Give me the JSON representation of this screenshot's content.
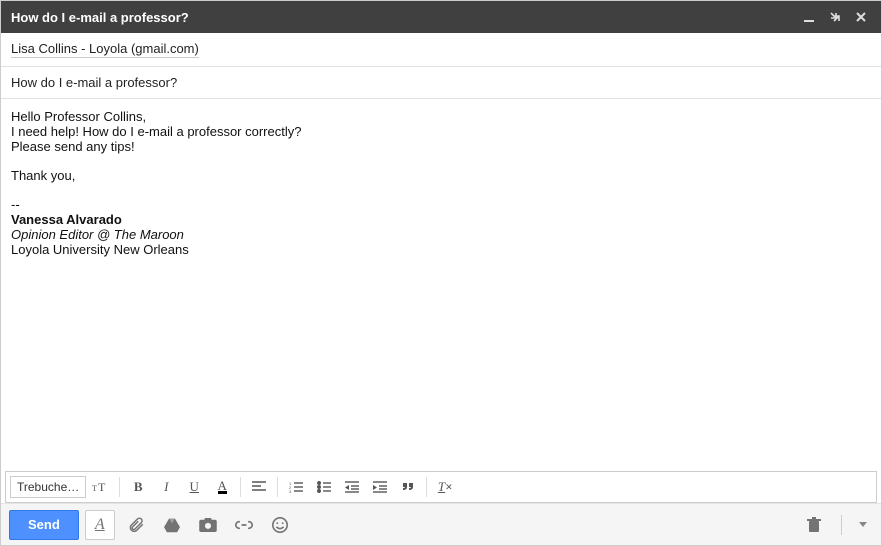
{
  "window": {
    "title": "How do I e-mail a professor?"
  },
  "to": {
    "chip": "Lisa Collins - Loyola (gmail.com)"
  },
  "subject": "How do I e-mail a professor?",
  "body": {
    "line1": "Hello Professor Collins,",
    "line2": "I need help! How do I e-mail a professor correctly?",
    "line3": "Please send any tips!",
    "thanks": "Thank you,",
    "sig_sep": "--",
    "sig_name": "Vanessa Alvarado",
    "sig_role": "Opinion Editor @ The Maroon",
    "sig_org": "Loyola University New Orleans"
  },
  "format": {
    "font_label": "Trebuche…"
  },
  "actions": {
    "send": "Send"
  }
}
